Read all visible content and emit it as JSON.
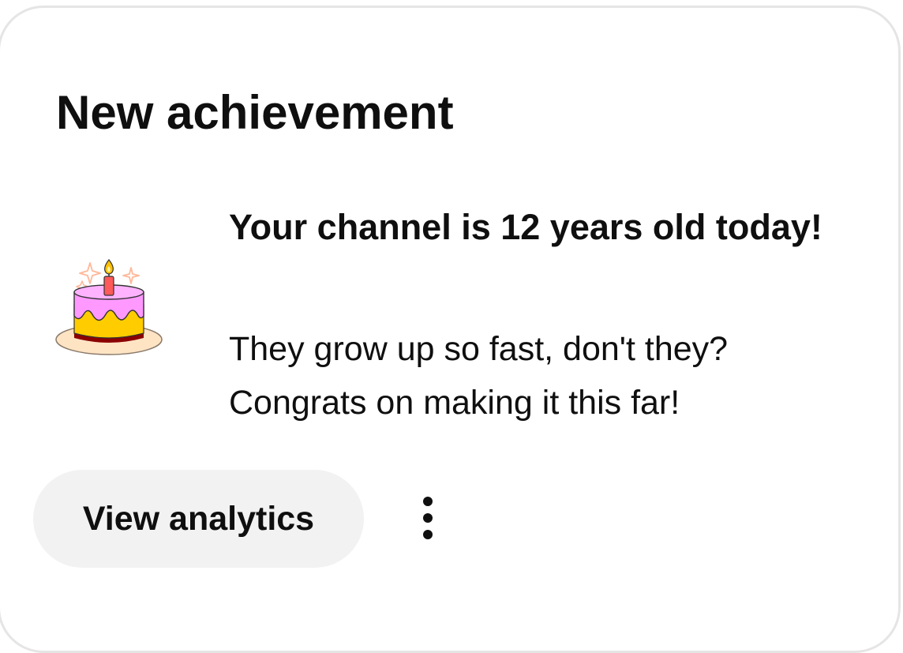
{
  "card": {
    "title": "New achievement",
    "headline": "Your channel is 12 years old today!",
    "body_line_1": "They grow up so fast, don't they?",
    "body_line_2": "Congrats on making it this far!",
    "illustration": "birthday-cake-icon"
  },
  "actions": {
    "primary_label": "View analytics",
    "more_icon": "more-vert-icon"
  },
  "colors": {
    "text": "#0f0f0f",
    "button_bg": "#f2f2f2",
    "card_border": "#e5e5e5",
    "frosting": "#ff99ff",
    "cake_base": "#ffcc00",
    "cake_band": "#8b0000",
    "plate": "#ffe4c4",
    "candle": "#ff5a5a",
    "flame": "#ffc000",
    "sparkle": "#ffb899"
  }
}
